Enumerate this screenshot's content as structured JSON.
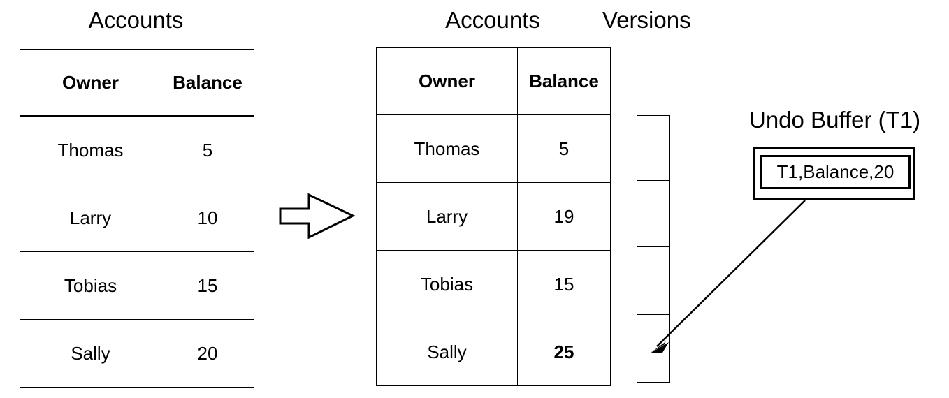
{
  "diagram": {
    "titles": {
      "accounts_before": "Accounts",
      "accounts_after": "Accounts",
      "versions": "Versions",
      "undo_buffer": "Undo Buffer (T1)"
    },
    "table_before": {
      "headers": [
        "Owner",
        "Balance"
      ],
      "rows": [
        {
          "owner": "Thomas",
          "balance": "5",
          "bold": false
        },
        {
          "owner": "Larry",
          "balance": "10",
          "bold": false
        },
        {
          "owner": "Tobias",
          "balance": "15",
          "bold": false
        },
        {
          "owner": "Sally",
          "balance": "20",
          "bold": false
        }
      ]
    },
    "table_after": {
      "headers": [
        "Owner",
        "Balance"
      ],
      "rows": [
        {
          "owner": "Thomas",
          "balance": "5",
          "bold": false
        },
        {
          "owner": "Larry",
          "balance": "19",
          "bold": false
        },
        {
          "owner": "Tobias",
          "balance": "15",
          "bold": false
        },
        {
          "owner": "Sally",
          "balance": "25",
          "bold": true
        }
      ]
    },
    "versions_column": {
      "cell_count": 4,
      "cells": [
        "",
        "",
        "",
        ""
      ]
    },
    "undo_buffer": {
      "entries": [
        "T1,Balance,20"
      ]
    },
    "connectors": {
      "transform_arrow": "block-arrow-right",
      "undo_pointer": "arrow-to-version-slot"
    },
    "colors": {
      "stroke": "#000000",
      "background": "#ffffff",
      "text": "#000000"
    }
  }
}
